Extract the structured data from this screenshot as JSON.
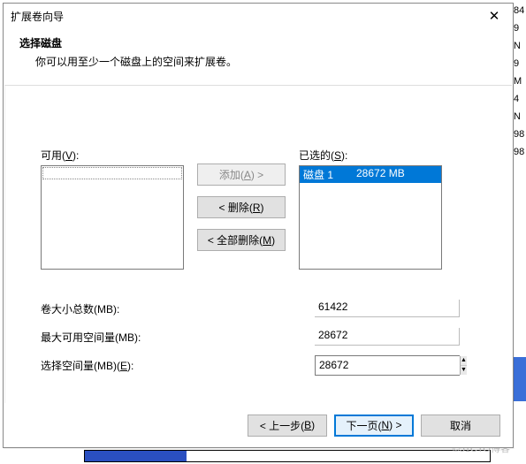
{
  "bg": {
    "r1": "84",
    "r2": "9 N",
    "r3": "9 M",
    "r4": "4 N",
    "r5": "98",
    "r6": "98"
  },
  "watermark": "©51CTO博客",
  "dialog": {
    "title": "扩展卷向导",
    "close": "✕",
    "heading": "选择磁盘",
    "subheading": "你可以用至少一个磁盘上的空间来扩展卷。"
  },
  "lists": {
    "available_label_pre": "可用(",
    "available_hot": "V",
    "available_label_post": "):",
    "selected_label_pre": "已选的(",
    "selected_hot": "S",
    "selected_label_post": "):",
    "selected_item_name": "磁盘 1",
    "selected_item_size": "28672 MB"
  },
  "buttons": {
    "add_pre": "添加(",
    "add_hot": "A",
    "add_post": ") >",
    "remove_pre": "< 删除(",
    "remove_hot": "R",
    "remove_post": ")",
    "remove_all_pre": "< 全部删除(",
    "remove_all_hot": "M",
    "remove_all_post": ")"
  },
  "fields": {
    "total_label": "卷大小总数(MB):",
    "total_value": "61422",
    "max_label": "最大可用空间量(MB):",
    "max_value": "28672",
    "sel_label_pre": "选择空间量(MB)(",
    "sel_hot": "E",
    "sel_label_post": "):",
    "sel_value": "28672"
  },
  "footer": {
    "back_pre": "< 上一步(",
    "back_hot": "B",
    "back_post": ")",
    "next_pre": "下一页(",
    "next_hot": "N",
    "next_post": ") >",
    "cancel": "取消"
  }
}
